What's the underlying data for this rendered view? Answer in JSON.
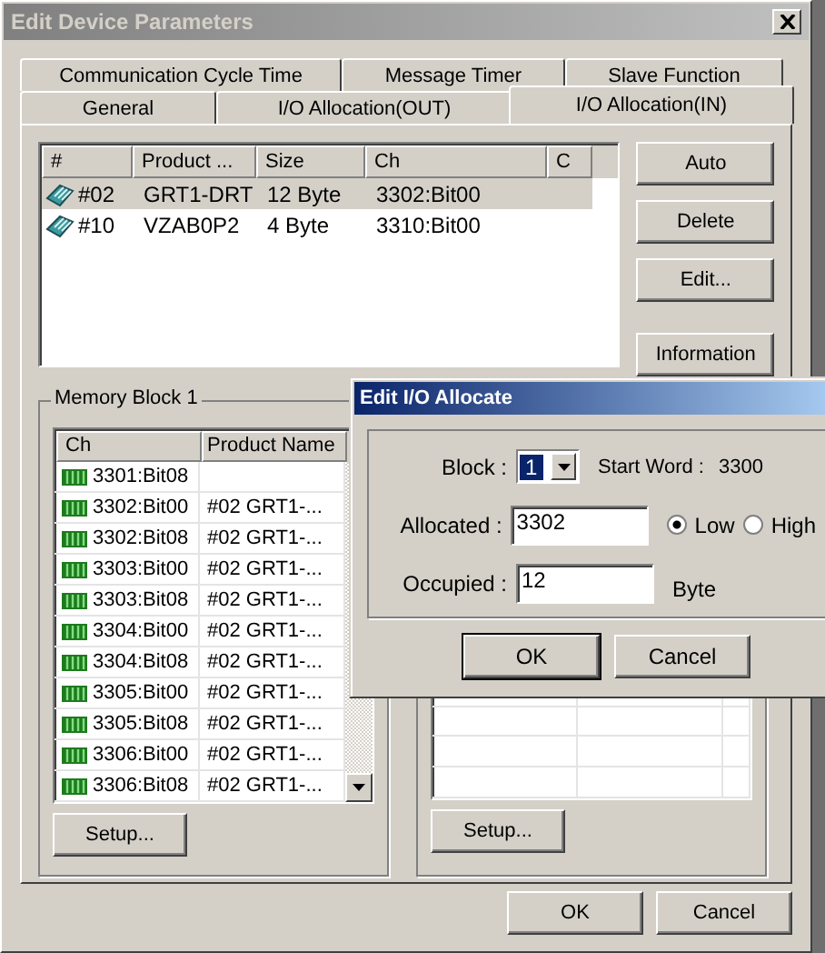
{
  "window": {
    "title": "Edit Device Parameters"
  },
  "tab_rows": [
    [
      {
        "label": "Communication Cycle Time",
        "selected": false
      },
      {
        "label": "Message Timer",
        "selected": false
      },
      {
        "label": "Slave Function",
        "selected": false
      }
    ],
    [
      {
        "label": "General",
        "selected": false
      },
      {
        "label": "I/O Allocation(OUT)",
        "selected": false
      },
      {
        "label": "I/O Allocation(IN)",
        "selected": true
      }
    ]
  ],
  "device_list": {
    "columns": [
      "#",
      "Product ...",
      "Size",
      "Ch",
      "C"
    ],
    "rows": [
      {
        "cells": [
          "#02",
          "GRT1-DRT",
          "12 Byte",
          "3302:Bit00"
        ],
        "selected": true
      },
      {
        "cells": [
          "#10",
          "VZAB0P2",
          "4 Byte",
          "3310:Bit00"
        ],
        "selected": false
      }
    ]
  },
  "side_buttons": [
    "Auto",
    "Delete",
    "Edit...",
    "Information"
  ],
  "memory_block": {
    "title": "Memory Block 1",
    "columns": [
      "Ch",
      "Product Name"
    ],
    "rows": [
      {
        "ch": "3301:Bit08",
        "product": ""
      },
      {
        "ch": "3302:Bit00",
        "product": "#02 GRT1-..."
      },
      {
        "ch": "3302:Bit08",
        "product": "#02 GRT1-..."
      },
      {
        "ch": "3303:Bit00",
        "product": "#02 GRT1-..."
      },
      {
        "ch": "3303:Bit08",
        "product": "#02 GRT1-..."
      },
      {
        "ch": "3304:Bit00",
        "product": "#02 GRT1-..."
      },
      {
        "ch": "3304:Bit08",
        "product": "#02 GRT1-..."
      },
      {
        "ch": "3305:Bit00",
        "product": "#02 GRT1-..."
      },
      {
        "ch": "3305:Bit08",
        "product": "#02 GRT1-..."
      },
      {
        "ch": "3306:Bit00",
        "product": "#02 GRT1-..."
      },
      {
        "ch": "3306:Bit08",
        "product": "#02 GRT1-..."
      }
    ],
    "setup_button": "Setup..."
  },
  "second_block": {
    "setup_button": "Setup..."
  },
  "footer_buttons": [
    "OK",
    "Cancel"
  ],
  "dialog": {
    "title": "Edit I/O Allocate",
    "block_label": "Block :",
    "block_value": "1",
    "start_word_label": "Start Word :",
    "start_word": "3300",
    "allocated_label": "Allocated :",
    "allocated_value": "3302",
    "radios": [
      {
        "label": "Low",
        "selected": true
      },
      {
        "label": "High",
        "selected": false
      }
    ],
    "occupied_label": "Occupied :",
    "occupied_value": "12",
    "unit": "Byte",
    "buttons": [
      "OK",
      "Cancel"
    ]
  }
}
